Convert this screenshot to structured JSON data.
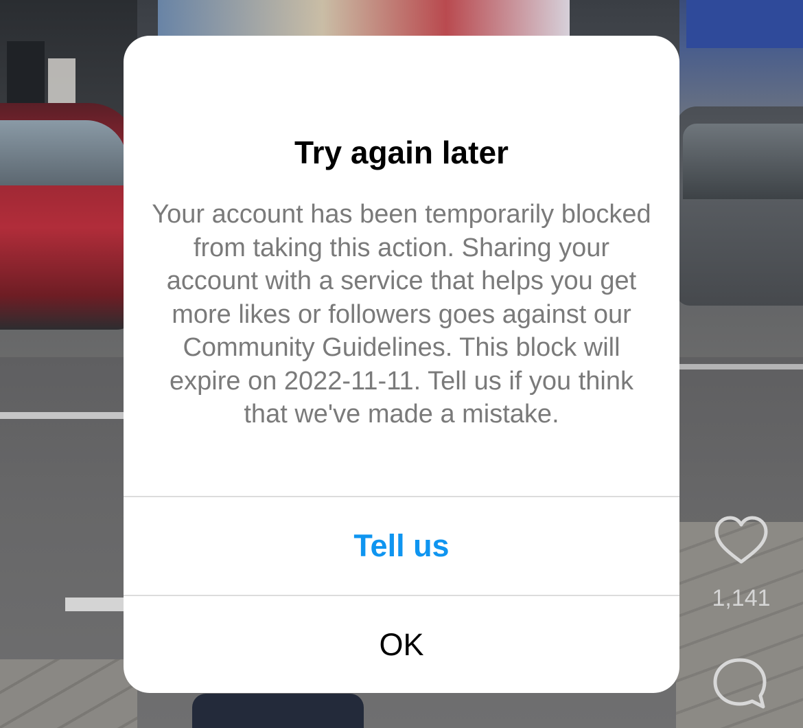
{
  "dialog": {
    "title": "Try again later",
    "message": "Your account has been temporarily blocked from taking this action. Sharing your account with a service that helps you get more likes or followers goes against our Community Guidelines. This block will expire on 2022-11-11. Tell us if you think that we've made a mistake.",
    "buttons": {
      "tell_us": "Tell us",
      "ok": "OK"
    }
  },
  "reel_actions": {
    "like_icon": "heart-icon",
    "like_count": "1,141",
    "comment_icon": "comment-icon"
  },
  "colors": {
    "accent": "#0f95f0",
    "dialog_bg": "#ffffff",
    "message_text": "#7a7a7a"
  }
}
